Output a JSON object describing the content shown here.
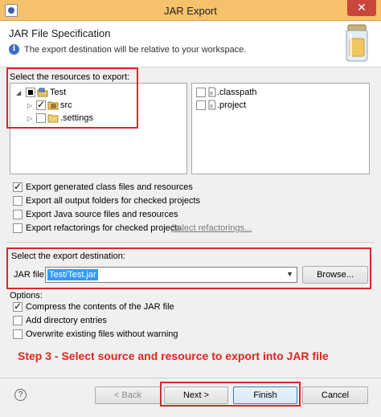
{
  "window": {
    "title": "JAR Export",
    "close_glyph": "✕"
  },
  "header": {
    "title": "JAR File Specification",
    "message": "The export destination will be relative to your workspace.",
    "info_icon": "info-icon"
  },
  "resources": {
    "label": "Select the resources to export:",
    "tree": [
      {
        "label": "Test",
        "state": "partial",
        "expanded": true,
        "icon": "project-icon"
      },
      {
        "label": "src",
        "state": "checked",
        "expanded": false,
        "icon": "package-folder-icon"
      },
      {
        "label": ".settings",
        "state": "unchecked",
        "expanded": false,
        "icon": "folder-icon"
      }
    ],
    "files": [
      {
        "label": ".classpath",
        "state": "unchecked",
        "icon": "xml-file-icon"
      },
      {
        "label": ".project",
        "state": "unchecked",
        "icon": "xml-file-icon"
      }
    ]
  },
  "options_top": [
    {
      "label": "Export generated class files and resources",
      "checked": true
    },
    {
      "label": "Export all output folders for checked projects",
      "checked": false
    },
    {
      "label": "Export Java source files and resources",
      "checked": false
    },
    {
      "label": "Export refactorings for checked projects.",
      "checked": false
    }
  ],
  "select_refactorings_link": "Select refactorings...",
  "destination": {
    "label": "Select the export destination:",
    "jar_file_label": "JAR file:",
    "jar_file_value": "Test/Test.jar",
    "browse_label": "Browse..."
  },
  "options": {
    "label": "Options:",
    "items": [
      {
        "label": "Compress the contents of the JAR file",
        "checked": true
      },
      {
        "label": "Add directory entries",
        "checked": false
      },
      {
        "label": "Overwrite existing files without warning",
        "checked": false
      }
    ]
  },
  "annotation": "Step 3 - Select source and resource to export into JAR file",
  "buttons": {
    "help": "?",
    "back": "< Back",
    "next": "Next >",
    "finish": "Finish",
    "cancel": "Cancel"
  },
  "colors": {
    "highlight_red": "#d9262c",
    "selection_blue": "#3399ff",
    "titlebar": "#f5c16a"
  }
}
